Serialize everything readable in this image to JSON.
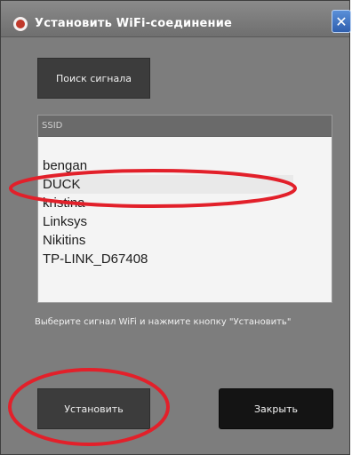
{
  "window": {
    "title": "Установить WiFi-соединение",
    "close_glyph": "✕"
  },
  "search_button": {
    "label": "Поиск сигнала"
  },
  "network_list": {
    "header": "SSID",
    "items": [
      "bengan",
      "DUCK",
      "kristina",
      "Linksys",
      "Nikitins",
      "TP-LINK_D67408"
    ],
    "selected": "DUCK"
  },
  "hint": "Выберите сигнал WiFi и нажмите кнопку \"Установить\"",
  "buttons": {
    "install_label": "Установить",
    "close_label": "Закрыть"
  },
  "colors": {
    "annotation": "#e2202a",
    "window_bg": "#7d7d7d"
  }
}
